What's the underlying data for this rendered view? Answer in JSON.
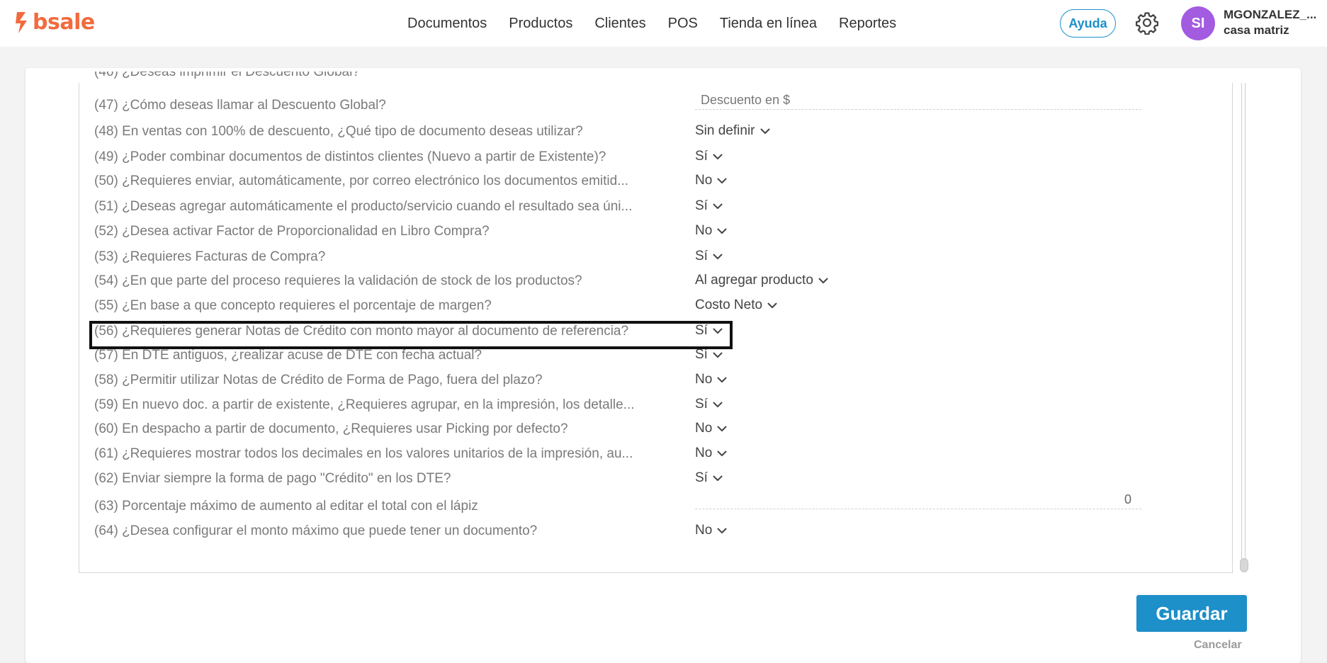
{
  "header": {
    "logo_text": "bsale",
    "nav": [
      "Documentos",
      "Productos",
      "Clientes",
      "POS",
      "Tienda en línea",
      "Reportes"
    ],
    "help_label": "Ayuda",
    "avatar_initials": "SI",
    "user_name": "MGONZALEZ_...",
    "branch": "casa matriz"
  },
  "settings": {
    "partial_top": "(46) ¿Deseas imprimir el Descuento Global?",
    "rows": [
      {
        "question": "(47) ¿Cómo deseas llamar al Descuento Global?",
        "type": "input",
        "placeholder": "Descuento en $"
      },
      {
        "question": "(48) En ventas con 100% de descuento, ¿Qué tipo de documento deseas utilizar?",
        "type": "select",
        "value": "Sin definir"
      },
      {
        "question": "(49) ¿Poder combinar documentos de distintos clientes (Nuevo a partir de Existente)?",
        "type": "select",
        "value": "Sí"
      },
      {
        "question": "(50) ¿Requieres enviar, automáticamente, por correo electrónico los documentos emitid...",
        "type": "select",
        "value": "No"
      },
      {
        "question": "(51) ¿Deseas agregar automáticamente el producto/servicio cuando el resultado sea úni...",
        "type": "select",
        "value": "Sí"
      },
      {
        "question": "(52) ¿Desea activar Factor de Proporcionalidad en Libro Compra?",
        "type": "select",
        "value": "No"
      },
      {
        "question": "(53) ¿Requieres Facturas de Compra?",
        "type": "select",
        "value": "Sí"
      },
      {
        "question": "(54) ¿En que parte del proceso requieres la validación de stock de los productos?",
        "type": "select",
        "value": "Al agregar producto"
      },
      {
        "question": "(55) ¿En base a que concepto requieres el porcentaje de margen?",
        "type": "select",
        "value": "Costo Neto"
      },
      {
        "question": "(56) ¿Requieres generar Notas de Crédito con monto mayor al documento de referencia?",
        "type": "select",
        "value": "Sí"
      },
      {
        "question": "(57) En DTE antiguos, ¿realizar acuse de DTE con fecha actual?",
        "type": "select",
        "value": "Sí"
      },
      {
        "question": "(58) ¿Permitir utilizar Notas de Crédito de Forma de Pago, fuera del plazo?",
        "type": "select",
        "value": "No"
      },
      {
        "question": "(59) En nuevo doc. a partir de existente, ¿Requieres agrupar, en la impresión, los detalle...",
        "type": "select",
        "value": "Sí"
      },
      {
        "question": "(60) En despacho a partir de documento, ¿Requieres usar Picking por defecto?",
        "type": "select",
        "value": "No"
      },
      {
        "question": "(61) ¿Requieres mostrar todos los decimales en los valores unitarios de la impresión, au...",
        "type": "select",
        "value": "No"
      },
      {
        "question": "(62) Enviar siempre la forma de pago \"Crédito\" en los DTE?",
        "type": "select",
        "value": "Sí"
      },
      {
        "question": "(63) Porcentaje máximo de aumento al editar el total con el lápiz",
        "type": "number",
        "value": "0"
      },
      {
        "question": "(64) ¿Desea configurar el monto máximo que puede tener un documento?",
        "type": "select",
        "value": "No"
      }
    ]
  },
  "actions": {
    "save_label": "Guardar",
    "cancel_label": "Cancelar"
  }
}
